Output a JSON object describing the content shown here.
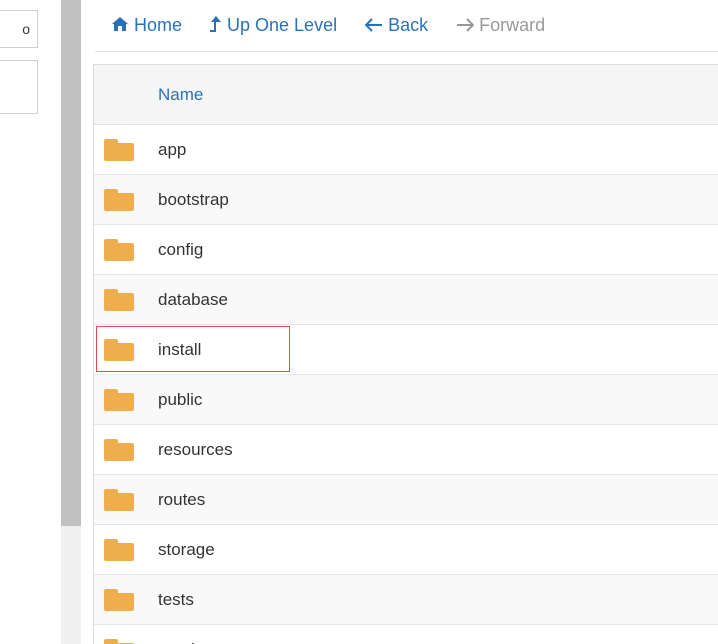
{
  "left_panel": {
    "box1_text": "o"
  },
  "toolbar": {
    "home_label": "Home",
    "up_label": "Up One Level",
    "back_label": "Back",
    "forward_label": "Forward"
  },
  "table": {
    "header_name": "Name",
    "rows": [
      {
        "name": "app"
      },
      {
        "name": "bootstrap"
      },
      {
        "name": "config"
      },
      {
        "name": "database"
      },
      {
        "name": "install",
        "highlighted": true
      },
      {
        "name": "public"
      },
      {
        "name": "resources"
      },
      {
        "name": "routes"
      },
      {
        "name": "storage"
      },
      {
        "name": "tests"
      },
      {
        "name": "vendor"
      }
    ]
  },
  "icons": {
    "home": "home-icon",
    "up": "level-up-icon",
    "back": "arrow-left-icon",
    "forward": "arrow-right-icon",
    "folder": "folder-icon"
  },
  "colors": {
    "link": "#2a72b8",
    "disabled": "#999999",
    "folder": "#f0ad4e",
    "highlight": "#e74c4c"
  }
}
